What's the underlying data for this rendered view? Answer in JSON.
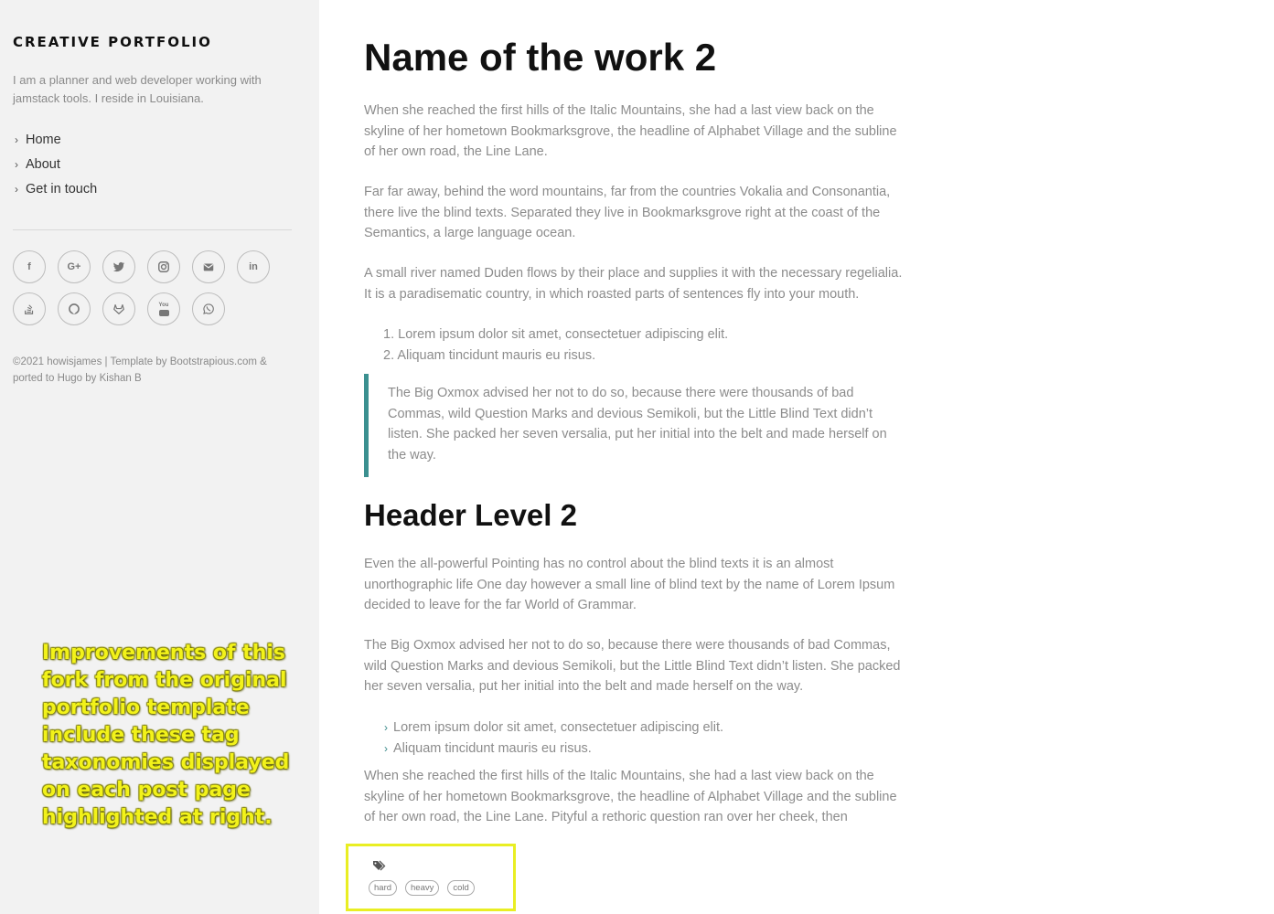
{
  "sidebar": {
    "brand": "CREATIVE PORTFOLIO",
    "bio": "I am a planner and web developer working with jamstack tools. I reside in Louisiana.",
    "nav": [
      {
        "label": "Home"
      },
      {
        "label": "About"
      },
      {
        "label": "Get in touch"
      }
    ],
    "socials": [
      {
        "icon": "facebook-icon",
        "glyph": "f"
      },
      {
        "icon": "google-plus-icon",
        "glyph": "G+"
      },
      {
        "icon": "twitter-icon",
        "glyph": ""
      },
      {
        "icon": "instagram-icon",
        "glyph": ""
      },
      {
        "icon": "email-icon",
        "glyph": ""
      },
      {
        "icon": "linkedin-icon",
        "glyph": "in"
      },
      {
        "icon": "stackoverflow-icon",
        "glyph": ""
      },
      {
        "icon": "github-icon",
        "glyph": ""
      },
      {
        "icon": "gitlab-icon",
        "glyph": ""
      },
      {
        "icon": "youtube-icon",
        "glyph": "You"
      },
      {
        "icon": "whatsapp-icon",
        "glyph": ""
      }
    ],
    "footer": "©2021 howisjames | Template by Bootstrapious.com & ported to Hugo by Kishan B",
    "annotation": "Improvements of this fork from the original portfolio template include these tag taxonomies displayed on each post page highlighted at right."
  },
  "article": {
    "title": "Name of the work 2",
    "p1": "When she reached the first hills of the Italic Mountains, she had a last view back on the skyline of her hometown Bookmarksgrove, the headline of Alphabet Village and the subline of her own road, the Line Lane.",
    "p2": "Far far away, behind the word mountains, far from the countries Vokalia and Consonantia, there live the blind texts. Separated they live in Bookmarksgrove right at the coast of the Semantics, a large language ocean.",
    "p3": "A small river named Duden flows by their place and supplies it with the necessary regelialia. It is a paradisematic country, in which roasted parts of sentences fly into your mouth.",
    "ordered": [
      {
        "num": "1.",
        "text": "Lorem ipsum dolor sit amet, consectetuer adipiscing elit."
      },
      {
        "num": "2.",
        "text": "Aliquam tincidunt mauris eu risus."
      }
    ],
    "quote": "The Big Oxmox advised her not to do so, because there were thousands of bad Commas, wild Question Marks and devious Semikoli, but the Little Blind Text didn’t listen. She packed her seven versalia, put her initial into the belt and made herself on the way.",
    "h2": "Header Level 2",
    "p4": "Even the all-powerful Pointing has no control about the blind texts it is an almost unorthographic life One day however a small line of blind text by the name of Lorem Ipsum decided to leave for the far World of Grammar.",
    "p5": "The Big Oxmox advised her not to do so, because there were thousands of bad Commas, wild Question Marks and devious Semikoli, but the Little Blind Text didn’t listen. She packed her seven versalia, put her initial into the belt and made herself on the way.",
    "unordered": [
      "Lorem ipsum dolor sit amet, consectetuer adipiscing elit.",
      "Aliquam tincidunt mauris eu risus."
    ],
    "p6": "When she reached the first hills of the Italic Mountains, she had a last view back on the skyline of her hometown Bookmarksgrove, the headline of Alphabet Village and the subline of her own road, the Line Lane. Pityful a rethoric question ran over her cheek, then",
    "tags": [
      "hard",
      "heavy",
      "cold"
    ],
    "colors": {
      "accent": "#3b9090",
      "highlight": "#e9ee23"
    }
  }
}
